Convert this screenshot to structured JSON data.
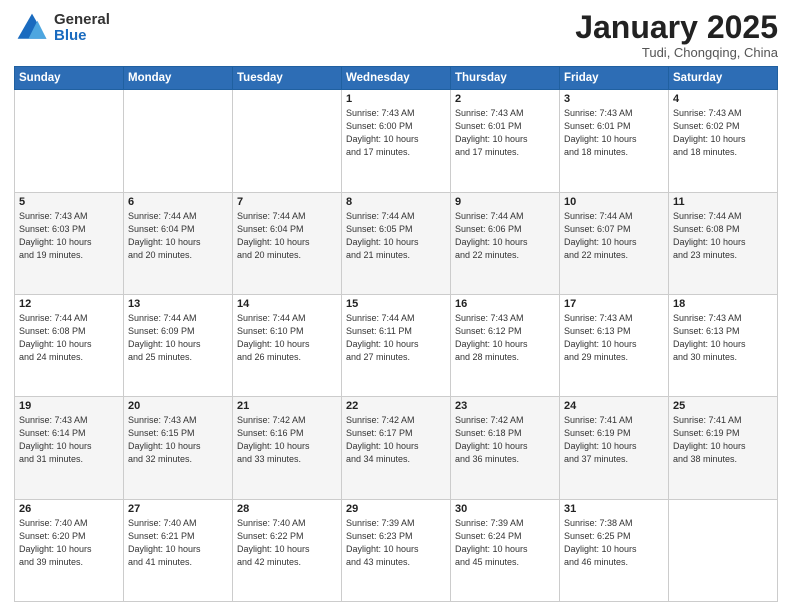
{
  "logo": {
    "general": "General",
    "blue": "Blue"
  },
  "title": {
    "month": "January 2025",
    "location": "Tudi, Chongqing, China"
  },
  "weekdays": [
    "Sunday",
    "Monday",
    "Tuesday",
    "Wednesday",
    "Thursday",
    "Friday",
    "Saturday"
  ],
  "weeks": [
    [
      {
        "day": "",
        "info": ""
      },
      {
        "day": "",
        "info": ""
      },
      {
        "day": "",
        "info": ""
      },
      {
        "day": "1",
        "info": "Sunrise: 7:43 AM\nSunset: 6:00 PM\nDaylight: 10 hours\nand 17 minutes."
      },
      {
        "day": "2",
        "info": "Sunrise: 7:43 AM\nSunset: 6:01 PM\nDaylight: 10 hours\nand 17 minutes."
      },
      {
        "day": "3",
        "info": "Sunrise: 7:43 AM\nSunset: 6:01 PM\nDaylight: 10 hours\nand 18 minutes."
      },
      {
        "day": "4",
        "info": "Sunrise: 7:43 AM\nSunset: 6:02 PM\nDaylight: 10 hours\nand 18 minutes."
      }
    ],
    [
      {
        "day": "5",
        "info": "Sunrise: 7:43 AM\nSunset: 6:03 PM\nDaylight: 10 hours\nand 19 minutes."
      },
      {
        "day": "6",
        "info": "Sunrise: 7:44 AM\nSunset: 6:04 PM\nDaylight: 10 hours\nand 20 minutes."
      },
      {
        "day": "7",
        "info": "Sunrise: 7:44 AM\nSunset: 6:04 PM\nDaylight: 10 hours\nand 20 minutes."
      },
      {
        "day": "8",
        "info": "Sunrise: 7:44 AM\nSunset: 6:05 PM\nDaylight: 10 hours\nand 21 minutes."
      },
      {
        "day": "9",
        "info": "Sunrise: 7:44 AM\nSunset: 6:06 PM\nDaylight: 10 hours\nand 22 minutes."
      },
      {
        "day": "10",
        "info": "Sunrise: 7:44 AM\nSunset: 6:07 PM\nDaylight: 10 hours\nand 22 minutes."
      },
      {
        "day": "11",
        "info": "Sunrise: 7:44 AM\nSunset: 6:08 PM\nDaylight: 10 hours\nand 23 minutes."
      }
    ],
    [
      {
        "day": "12",
        "info": "Sunrise: 7:44 AM\nSunset: 6:08 PM\nDaylight: 10 hours\nand 24 minutes."
      },
      {
        "day": "13",
        "info": "Sunrise: 7:44 AM\nSunset: 6:09 PM\nDaylight: 10 hours\nand 25 minutes."
      },
      {
        "day": "14",
        "info": "Sunrise: 7:44 AM\nSunset: 6:10 PM\nDaylight: 10 hours\nand 26 minutes."
      },
      {
        "day": "15",
        "info": "Sunrise: 7:44 AM\nSunset: 6:11 PM\nDaylight: 10 hours\nand 27 minutes."
      },
      {
        "day": "16",
        "info": "Sunrise: 7:43 AM\nSunset: 6:12 PM\nDaylight: 10 hours\nand 28 minutes."
      },
      {
        "day": "17",
        "info": "Sunrise: 7:43 AM\nSunset: 6:13 PM\nDaylight: 10 hours\nand 29 minutes."
      },
      {
        "day": "18",
        "info": "Sunrise: 7:43 AM\nSunset: 6:13 PM\nDaylight: 10 hours\nand 30 minutes."
      }
    ],
    [
      {
        "day": "19",
        "info": "Sunrise: 7:43 AM\nSunset: 6:14 PM\nDaylight: 10 hours\nand 31 minutes."
      },
      {
        "day": "20",
        "info": "Sunrise: 7:43 AM\nSunset: 6:15 PM\nDaylight: 10 hours\nand 32 minutes."
      },
      {
        "day": "21",
        "info": "Sunrise: 7:42 AM\nSunset: 6:16 PM\nDaylight: 10 hours\nand 33 minutes."
      },
      {
        "day": "22",
        "info": "Sunrise: 7:42 AM\nSunset: 6:17 PM\nDaylight: 10 hours\nand 34 minutes."
      },
      {
        "day": "23",
        "info": "Sunrise: 7:42 AM\nSunset: 6:18 PM\nDaylight: 10 hours\nand 36 minutes."
      },
      {
        "day": "24",
        "info": "Sunrise: 7:41 AM\nSunset: 6:19 PM\nDaylight: 10 hours\nand 37 minutes."
      },
      {
        "day": "25",
        "info": "Sunrise: 7:41 AM\nSunset: 6:19 PM\nDaylight: 10 hours\nand 38 minutes."
      }
    ],
    [
      {
        "day": "26",
        "info": "Sunrise: 7:40 AM\nSunset: 6:20 PM\nDaylight: 10 hours\nand 39 minutes."
      },
      {
        "day": "27",
        "info": "Sunrise: 7:40 AM\nSunset: 6:21 PM\nDaylight: 10 hours\nand 41 minutes."
      },
      {
        "day": "28",
        "info": "Sunrise: 7:40 AM\nSunset: 6:22 PM\nDaylight: 10 hours\nand 42 minutes."
      },
      {
        "day": "29",
        "info": "Sunrise: 7:39 AM\nSunset: 6:23 PM\nDaylight: 10 hours\nand 43 minutes."
      },
      {
        "day": "30",
        "info": "Sunrise: 7:39 AM\nSunset: 6:24 PM\nDaylight: 10 hours\nand 45 minutes."
      },
      {
        "day": "31",
        "info": "Sunrise: 7:38 AM\nSunset: 6:25 PM\nDaylight: 10 hours\nand 46 minutes."
      },
      {
        "day": "",
        "info": ""
      }
    ]
  ]
}
